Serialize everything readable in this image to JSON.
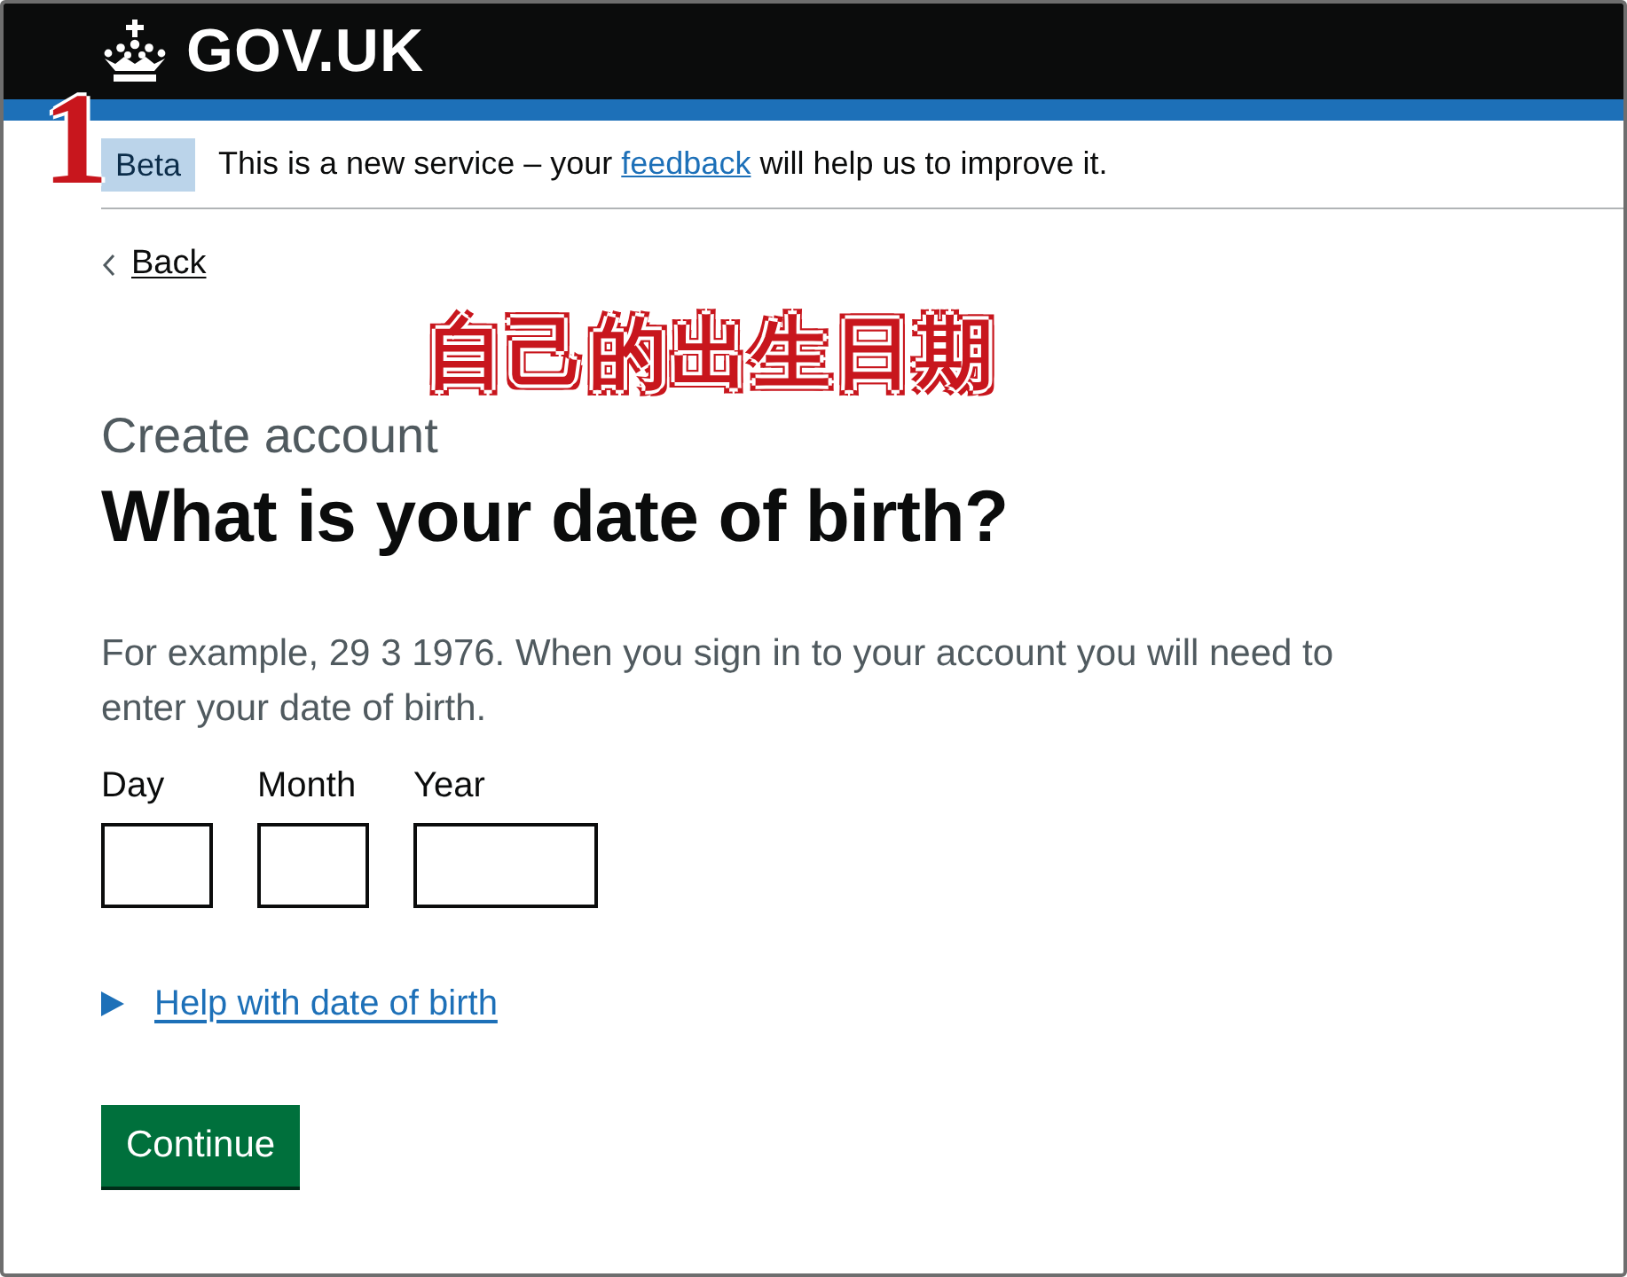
{
  "header": {
    "logo_text": "GOV.UK"
  },
  "phase_banner": {
    "tag": "Beta",
    "text_before": "This is a new service – your",
    "link": "feedback",
    "text_after": "will help us to improve it."
  },
  "back_link": "Back",
  "annotations": [
    {
      "kind": "number",
      "text": "1"
    },
    {
      "kind": "caption",
      "text": "自己的出生日期"
    }
  ],
  "caption": "Create account",
  "heading": "What is your date of birth?",
  "hint": "For example, 29 3 1976. When you sign in to your account you will need to enter your date of birth.",
  "date_fields": [
    {
      "label": "Day",
      "kind": "short"
    },
    {
      "label": "Month",
      "kind": "short"
    },
    {
      "label": "Year",
      "kind": "long"
    }
  ],
  "details": {
    "summary": "Help with date of birth",
    "expanded": false
  },
  "button": "Continue"
}
